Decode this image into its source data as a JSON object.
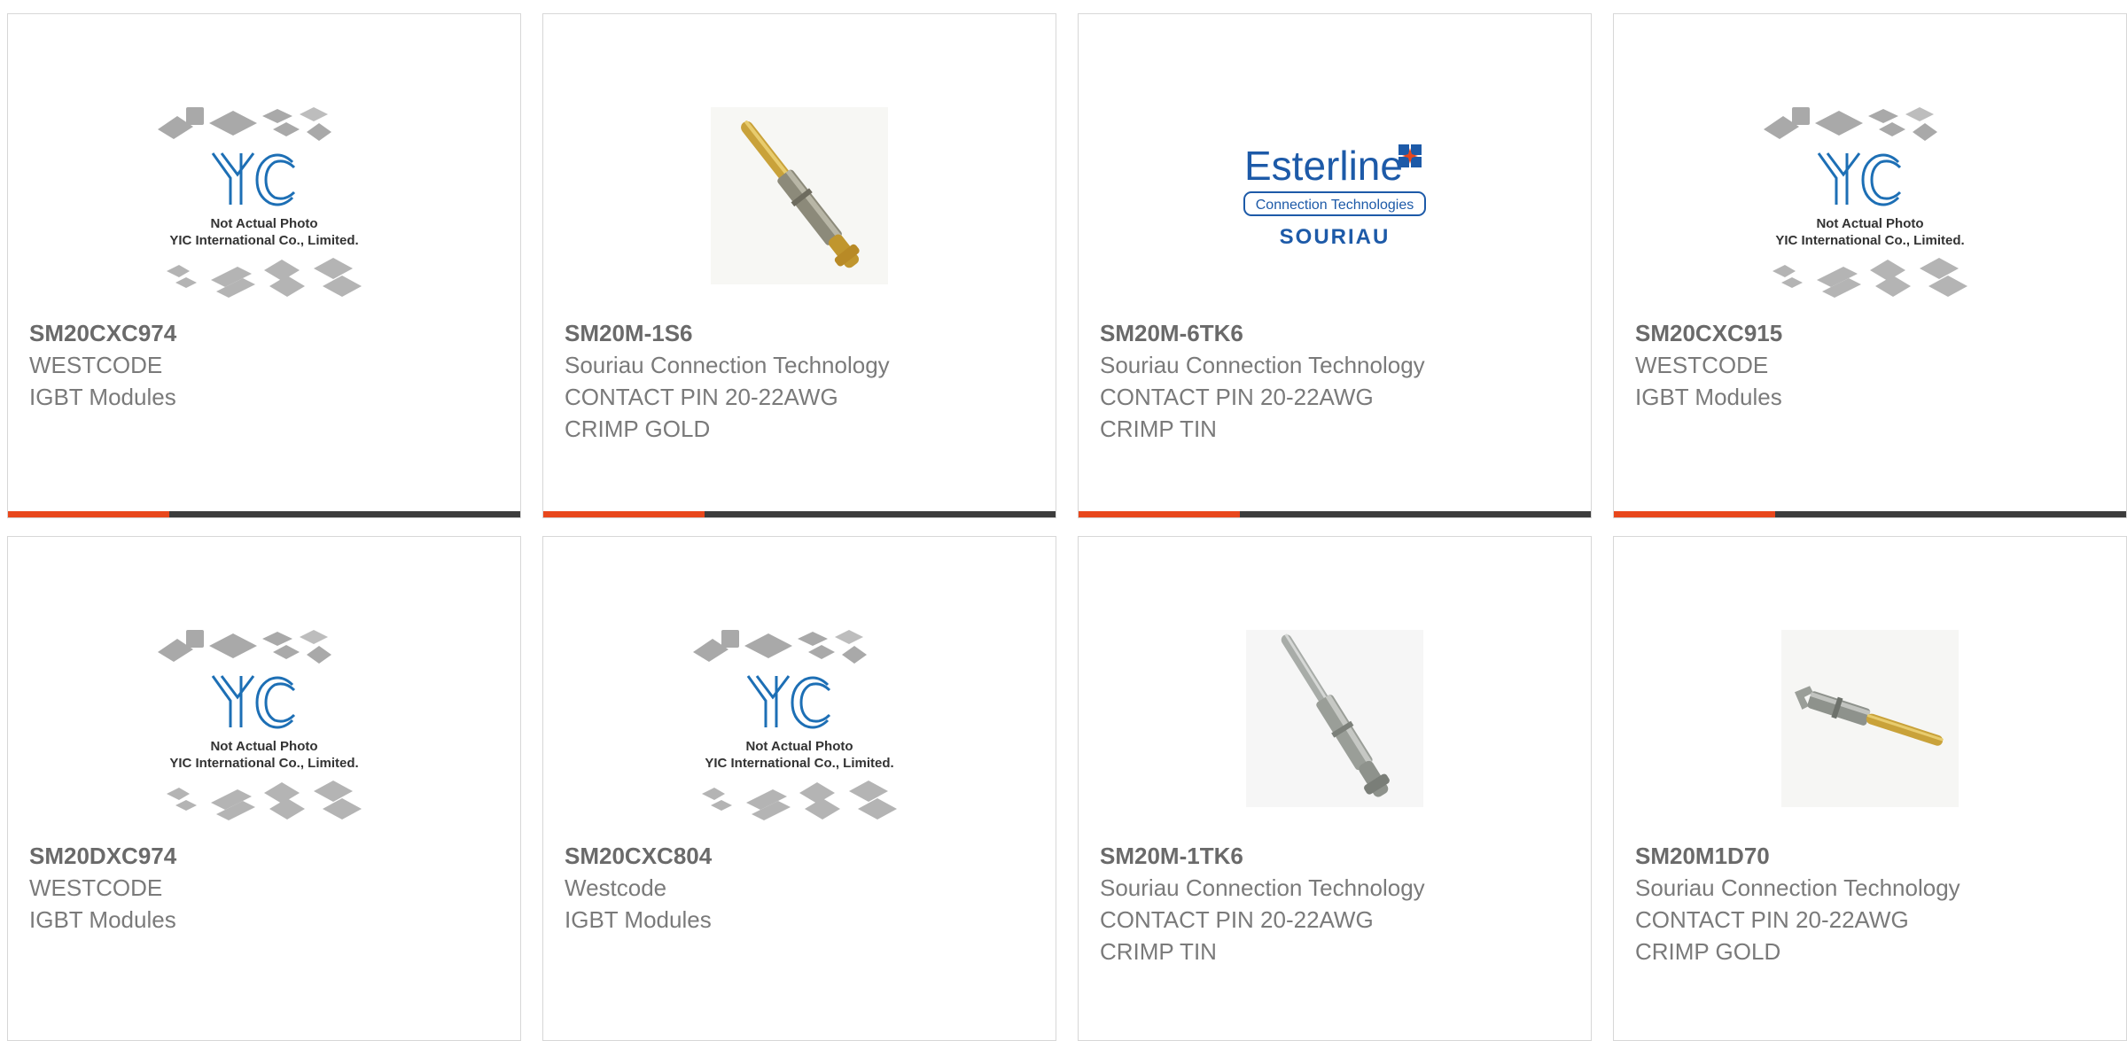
{
  "theme": {
    "accent_color": "#e8471c",
    "bar_color": "#3c3c3c",
    "yic_blue": "#1d6fb5",
    "esterline_blue": "#1d5aa8"
  },
  "placeholder": {
    "line1": "Not Actual Photo",
    "line2": "YIC International Co., Limited."
  },
  "esterline_logo": {
    "brand": "Esterline",
    "tagline": "Connection Technologies",
    "sub": "SOURIAU"
  },
  "products": [
    {
      "part": "SM20CXC974",
      "lines": [
        "WESTCODE",
        "IGBT Modules"
      ],
      "image": "yic-placeholder-icon"
    },
    {
      "part": "SM20M-1S6",
      "lines": [
        "Souriau Connection Technology",
        "CONTACT PIN 20-22AWG",
        "CRIMP GOLD"
      ],
      "image": "gold-contact-pin-icon"
    },
    {
      "part": "SM20M-6TK6",
      "lines": [
        "Souriau Connection Technology",
        "CONTACT PIN 20-22AWG",
        "CRIMP TIN"
      ],
      "image": "esterline-logo"
    },
    {
      "part": "SM20CXC915",
      "lines": [
        "WESTCODE",
        "IGBT Modules"
      ],
      "image": "yic-placeholder-icon"
    },
    {
      "part": "SM20DXC974",
      "lines": [
        "WESTCODE",
        "IGBT Modules"
      ],
      "image": "yic-placeholder-icon"
    },
    {
      "part": "SM20CXC804",
      "lines": [
        "Westcode",
        "IGBT Modules"
      ],
      "image": "yic-placeholder-icon"
    },
    {
      "part": "SM20M-1TK6",
      "lines": [
        "Souriau Connection Technology",
        "CONTACT PIN 20-22AWG",
        "CRIMP TIN"
      ],
      "image": "tin-contact-pin-icon"
    },
    {
      "part": "SM20M1D70",
      "lines": [
        "Souriau Connection Technology",
        "CONTACT PIN 20-22AWG",
        "CRIMP GOLD"
      ],
      "image": "gold-tip-contact-pin-icon"
    }
  ]
}
